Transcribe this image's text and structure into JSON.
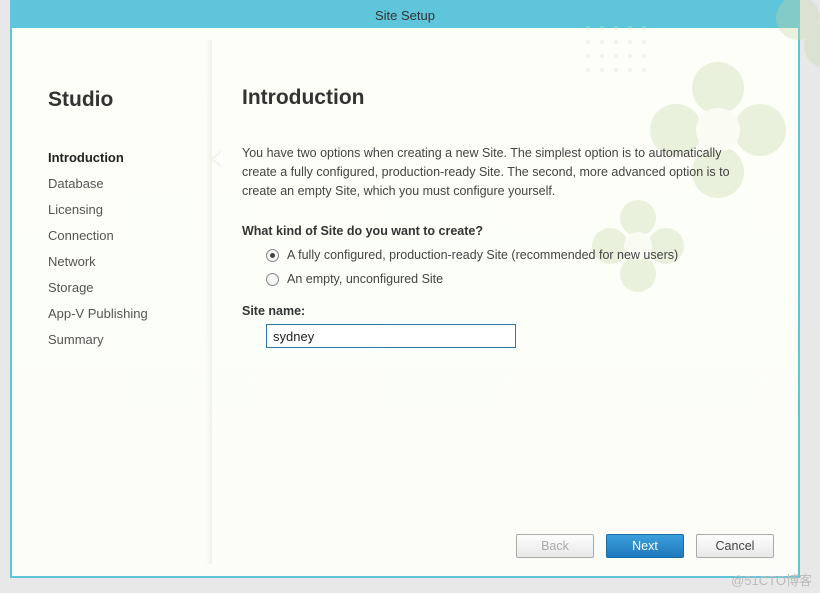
{
  "window": {
    "title": "Site Setup"
  },
  "sidebar": {
    "brand": "Studio",
    "items": [
      {
        "label": "Introduction",
        "active": true
      },
      {
        "label": "Database"
      },
      {
        "label": "Licensing"
      },
      {
        "label": "Connection"
      },
      {
        "label": "Network"
      },
      {
        "label": "Storage"
      },
      {
        "label": "App-V Publishing"
      },
      {
        "label": "Summary"
      }
    ]
  },
  "main": {
    "title": "Introduction",
    "intro": "You have two options when creating a new Site. The simplest option is to automatically create a fully configured, production-ready Site. The second, more advanced option is to create an empty Site, which you must configure yourself.",
    "question": "What kind of Site do you want to create?",
    "options": [
      {
        "label": "A fully configured, production-ready Site (recommended for new users)",
        "checked": true
      },
      {
        "label": "An empty, unconfigured Site",
        "checked": false
      }
    ],
    "siteNameLabel": "Site name:",
    "siteNameValue": "sydney"
  },
  "buttons": {
    "back": "Back",
    "next": "Next",
    "cancel": "Cancel"
  },
  "watermark": "@51CTO博客"
}
